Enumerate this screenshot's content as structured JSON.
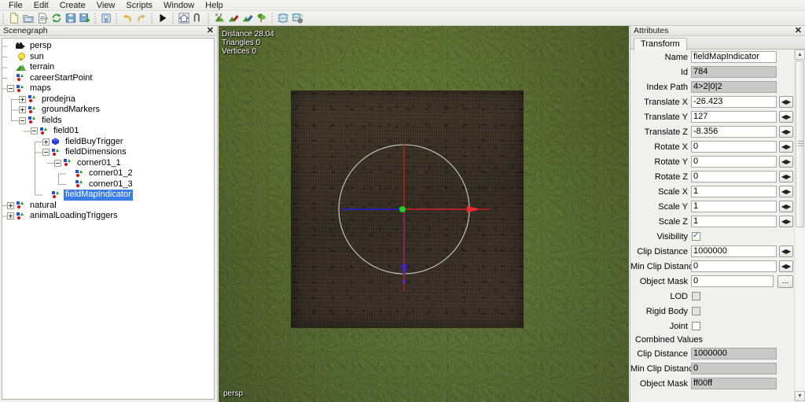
{
  "menu": {
    "items": [
      {
        "label": "File"
      },
      {
        "label": "Edit"
      },
      {
        "label": "Create"
      },
      {
        "label": "View"
      },
      {
        "label": "Scripts"
      },
      {
        "label": "Window"
      },
      {
        "label": "Help"
      }
    ]
  },
  "toolbar": {
    "groups": [
      {
        "buttons": [
          {
            "icon": "new-file-icon",
            "tooltip": "New"
          },
          {
            "icon": "open-folder-icon",
            "tooltip": "Open"
          },
          {
            "icon": "edit-document-icon",
            "tooltip": "Edit"
          },
          {
            "icon": "reload-icon",
            "tooltip": "Reload"
          },
          {
            "icon": "save-icon",
            "tooltip": "Save"
          },
          {
            "icon": "save-as-icon",
            "tooltip": "Save As"
          }
        ]
      },
      {
        "buttons": [
          {
            "icon": "import-icon",
            "tooltip": "Import"
          }
        ]
      },
      {
        "buttons": [
          {
            "icon": "undo-icon",
            "tooltip": "Undo"
          },
          {
            "icon": "redo-icon",
            "tooltip": "Redo"
          }
        ]
      },
      {
        "buttons": [
          {
            "icon": "play-icon",
            "tooltip": "Play"
          }
        ]
      },
      {
        "buttons": [
          {
            "icon": "home-icon",
            "tooltip": "Home"
          },
          {
            "icon": "transform-gizmo-icon",
            "tooltip": "Transform"
          }
        ]
      },
      {
        "buttons": [
          {
            "icon": "terrain-sculpt-icon",
            "tooltip": "Terrain Sculpt"
          },
          {
            "icon": "terrain-paint-icon",
            "tooltip": "Terrain Paint"
          },
          {
            "icon": "terrain-detail-icon",
            "tooltip": "Terrain Detail"
          },
          {
            "icon": "foliage-icon",
            "tooltip": "Foliage"
          }
        ]
      },
      {
        "buttons": [
          {
            "icon": "globe-icon",
            "tooltip": "Globe"
          },
          {
            "icon": "globe-settings-icon",
            "tooltip": "Globe Settings"
          }
        ]
      }
    ]
  },
  "scenegraph": {
    "title": "Scenegraph",
    "close_label": "✕",
    "nodes": [
      {
        "label": "persp",
        "depth": 0,
        "icon": "camera-icon",
        "expander": "none",
        "selected": false
      },
      {
        "label": "sun",
        "depth": 0,
        "icon": "light-icon",
        "expander": "none",
        "selected": false
      },
      {
        "label": "terrain",
        "depth": 0,
        "icon": "terrain-icon",
        "expander": "none",
        "selected": false
      },
      {
        "label": "careerStartPoint",
        "depth": 0,
        "icon": "transform-icon",
        "expander": "none",
        "selected": false
      },
      {
        "label": "maps",
        "depth": 0,
        "icon": "transform-icon",
        "expander": "minus",
        "selected": false
      },
      {
        "label": "prodejna",
        "depth": 1,
        "icon": "transform-icon",
        "expander": "plus",
        "selected": false
      },
      {
        "label": "groundMarkers",
        "depth": 1,
        "icon": "transform-icon",
        "expander": "plus",
        "selected": false
      },
      {
        "label": "fields",
        "depth": 1,
        "icon": "transform-icon",
        "expander": "minus",
        "selected": false
      },
      {
        "label": "field01",
        "depth": 2,
        "icon": "transform-icon",
        "expander": "minus",
        "selected": false
      },
      {
        "label": "fieldBuyTrigger",
        "depth": 3,
        "icon": "shape-icon",
        "expander": "plus",
        "selected": false
      },
      {
        "label": "fieldDimensions",
        "depth": 3,
        "icon": "transform-icon",
        "expander": "minus",
        "selected": false
      },
      {
        "label": "corner01_1",
        "depth": 4,
        "icon": "transform-icon",
        "expander": "minus",
        "selected": false
      },
      {
        "label": "corner01_2",
        "depth": 5,
        "icon": "transform-icon",
        "expander": "none",
        "selected": false
      },
      {
        "label": "corner01_3",
        "depth": 5,
        "icon": "transform-icon",
        "expander": "none",
        "selected": false
      },
      {
        "label": "fieldMapIndicator",
        "depth": 3,
        "icon": "transform-icon",
        "expander": "none",
        "selected": true
      },
      {
        "label": "natural",
        "depth": 0,
        "icon": "transform-icon",
        "expander": "plus",
        "selected": false
      },
      {
        "label": "animalLoadingTriggers",
        "depth": 0,
        "icon": "transform-icon",
        "expander": "plus",
        "selected": false
      }
    ]
  },
  "viewport": {
    "stats": {
      "distance_label": "Distance 28.04",
      "triangles_label": "Triangles 0",
      "vertices_label": "Vertices 0"
    },
    "camera_label": "persp",
    "colors": {
      "grass": "#5d7331",
      "field": "#3b3127",
      "axis_x": "#e01010",
      "axis_y": "#10c010",
      "axis_z": "#1010e0",
      "circle": "#dcdcd0"
    }
  },
  "attributes": {
    "title": "Attributes",
    "close_label": "✕",
    "tab": "Transform",
    "fields": [
      {
        "label": "Name",
        "value": "fieldMapIndicator",
        "type": "text",
        "readonly": false,
        "spinner": false
      },
      {
        "label": "Id",
        "value": "784",
        "type": "text",
        "readonly": true,
        "spinner": false
      },
      {
        "label": "Index Path",
        "value": "4>2|0|2",
        "type": "text",
        "readonly": true,
        "spinner": false
      },
      {
        "label": "Translate X",
        "value": "-26.423",
        "type": "text",
        "readonly": false,
        "spinner": true
      },
      {
        "label": "Translate Y",
        "value": "127",
        "type": "text",
        "readonly": false,
        "spinner": true
      },
      {
        "label": "Translate Z",
        "value": "-8.356",
        "type": "text",
        "readonly": false,
        "spinner": true
      },
      {
        "label": "Rotate X",
        "value": "0",
        "type": "text",
        "readonly": false,
        "spinner": true
      },
      {
        "label": "Rotate Y",
        "value": "0",
        "type": "text",
        "readonly": false,
        "spinner": true
      },
      {
        "label": "Rotate Z",
        "value": "0",
        "type": "text",
        "readonly": false,
        "spinner": true
      },
      {
        "label": "Scale X",
        "value": "1",
        "type": "text",
        "readonly": false,
        "spinner": true
      },
      {
        "label": "Scale Y",
        "value": "1",
        "type": "text",
        "readonly": false,
        "spinner": true
      },
      {
        "label": "Scale Z",
        "value": "1",
        "type": "text",
        "readonly": false,
        "spinner": true
      },
      {
        "label": "Visibility",
        "value": "",
        "type": "checkbox",
        "checked": true,
        "gray": false
      },
      {
        "label": "Clip Distance",
        "value": "1000000",
        "type": "text",
        "readonly": false,
        "spinner": true
      },
      {
        "label": "Min Clip Distance",
        "value": "0",
        "type": "text",
        "readonly": false,
        "spinner": true
      },
      {
        "label": "Object Mask",
        "value": "0",
        "type": "text",
        "readonly": false,
        "spinner": false,
        "dots": true,
        "dots_label": "..."
      },
      {
        "label": "LOD",
        "value": "",
        "type": "checkbox",
        "checked": false,
        "gray": true
      },
      {
        "label": "Rigid Body",
        "value": "",
        "type": "checkbox",
        "checked": false,
        "gray": true
      },
      {
        "label": "Joint",
        "value": "",
        "type": "checkbox",
        "checked": false,
        "gray": false
      }
    ],
    "combined_section_label": "Combined Values",
    "combined": [
      {
        "label": "Clip Distance",
        "value": "1000000"
      },
      {
        "label": "Min Clip Distance",
        "value": "0"
      },
      {
        "label": "Object Mask",
        "value": "ff00ff"
      }
    ],
    "scrollbar": {
      "up": "▲",
      "down": "▼"
    }
  }
}
